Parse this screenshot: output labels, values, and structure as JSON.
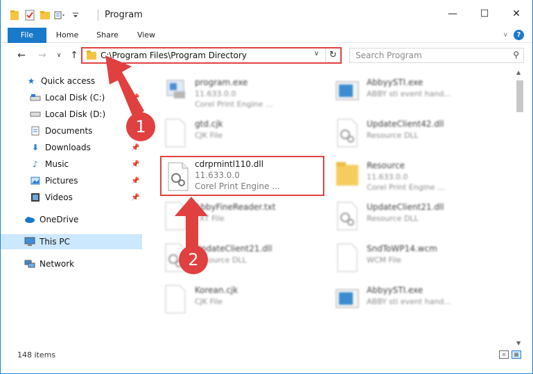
{
  "window": {
    "title": "Program",
    "minimize": "—",
    "maximize": "☐",
    "close": "✕"
  },
  "ribbon": {
    "tabs": [
      "File",
      "Home",
      "Share",
      "View"
    ],
    "expand": "∨",
    "help": "?"
  },
  "nav": {
    "back": "←",
    "forward": "→",
    "recent": "∨",
    "up": "↑",
    "address": "C:\\Program Files\\Program Directory",
    "address_dropdown": "∨",
    "refresh": "↻",
    "search_placeholder": "Search Program",
    "search_icon": "⚲"
  },
  "sidebar": {
    "items": [
      {
        "label": "Quick access",
        "icon": "star-icon"
      },
      {
        "label": "Local Disk (C:)",
        "icon": "drive-icon"
      },
      {
        "label": "Local Disk (D:)",
        "icon": "drive-icon"
      },
      {
        "label": "Documents",
        "icon": "documents-icon"
      },
      {
        "label": "Downloads",
        "icon": "download-icon"
      },
      {
        "label": "Music",
        "icon": "music-icon"
      },
      {
        "label": "Pictures",
        "icon": "pictures-icon"
      },
      {
        "label": "Videos",
        "icon": "videos-icon"
      },
      {
        "label": "OneDrive",
        "icon": "cloud-icon"
      },
      {
        "label": "This PC",
        "icon": "computer-icon"
      },
      {
        "label": "Network",
        "icon": "network-icon"
      }
    ]
  },
  "files": {
    "left": [
      {
        "name": "program.exe",
        "line1": "11.633.0.0",
        "line2": "Corel Print Engine ..."
      },
      {
        "name": "gtd.cjk",
        "line1": "CJK File",
        "line2": ""
      },
      {
        "name": "cdrprnintl110.dll",
        "line1": "11.633.0.0",
        "line2": "Corel Print Engine ..."
      },
      {
        "name": "AbbyFineReader.txt",
        "line1": "TXT File",
        "line2": ""
      },
      {
        "name": "UpdateClient21.dll",
        "line1": "Resource DLL",
        "line2": ""
      },
      {
        "name": "Korean.cjk",
        "line1": "CJK File",
        "line2": ""
      }
    ],
    "right": [
      {
        "name": "AbbyySTI.exe",
        "line1": "ABBY sti event hand...",
        "line2": ""
      },
      {
        "name": "UpdateClient42.dll",
        "line1": "Resource DLL",
        "line2": ""
      },
      {
        "name": "Resource",
        "line1": "11.633.0.0",
        "line2": "Corel Print Engine ..."
      },
      {
        "name": "UpdateClient21.dll",
        "line1": "Resource DLL",
        "line2": ""
      },
      {
        "name": "SndToWP14.wcm",
        "line1": "WCM File",
        "line2": ""
      },
      {
        "name": "AbbyySTI.exe",
        "line1": "ABBY sti event hand...",
        "line2": ""
      }
    ]
  },
  "status": {
    "count": "148 items"
  },
  "annotations": {
    "step1": "1",
    "step2": "2",
    "arrow_color": "#e04040"
  },
  "colors": {
    "accent": "#1979ca",
    "highlight": "#e04040",
    "selected": "#cce8ff"
  }
}
